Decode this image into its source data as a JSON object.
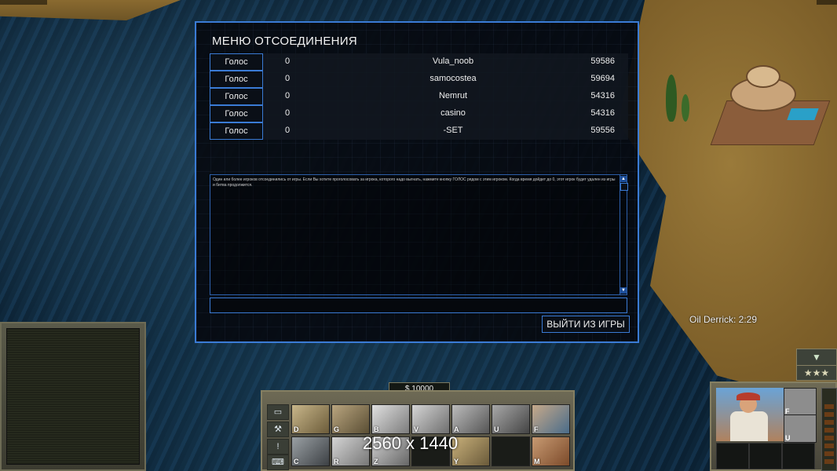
{
  "dialog": {
    "title": "МЕНЮ ОТСОЕДИНЕНИЯ",
    "players": [
      {
        "vote_label": "Голос",
        "votes": "0",
        "name": "Vula_noob",
        "id": "59586"
      },
      {
        "vote_label": "Голос",
        "votes": "0",
        "name": "samocostea",
        "id": "59694"
      },
      {
        "vote_label": "Голос",
        "votes": "0",
        "name": "Nemrut",
        "id": "54316"
      },
      {
        "vote_label": "Голос",
        "votes": "0",
        "name": "casino",
        "id": "54316"
      },
      {
        "vote_label": "Голос",
        "votes": "0",
        "name": "-SET",
        "id": "59556"
      }
    ],
    "message": "Один или более игроков отсоединились от игры. Если Вы хотите проголосовать за игрока, которого надо выгнать, нажмите кнопку ГОЛОС рядом с этим игроком. Когда время дойдет до 0, этот игрок будет удален из игры и битва продолжится.",
    "chat_value": "",
    "leave_label": "ВЫЙТИ ИЗ ИГРЫ",
    "scroll_up": "▲",
    "scroll_down": "▼"
  },
  "hud": {
    "oil_timer": "Oil Derrick: 2:29",
    "money": "$ 10000",
    "resolution_overlay": "2560 x 1440",
    "collapse_icon": "▼",
    "rank_stars": "★★★",
    "build_hotkeys": [
      "D",
      "G",
      "B",
      "V",
      "A",
      "U",
      "F",
      "C",
      "R",
      "Z",
      "",
      "Y",
      "",
      "M"
    ],
    "unit_hotkeys": [
      "F",
      "U"
    ],
    "side_icons": [
      "▭",
      "⚒",
      "!",
      "⌨"
    ]
  },
  "colors": {
    "accent": "#3a7bd5",
    "dialog_bg": "#060a10",
    "hud_frame": "#6e6a55"
  }
}
